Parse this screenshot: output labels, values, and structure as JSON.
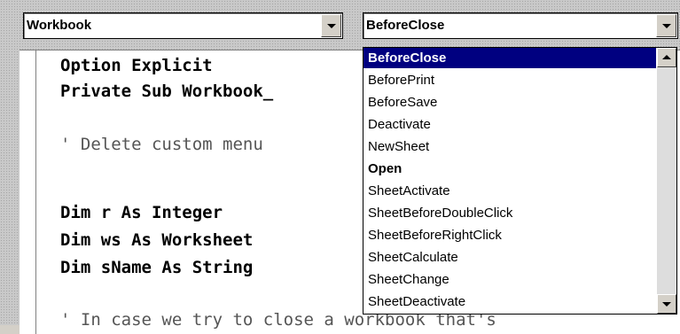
{
  "object_combo": {
    "value": "Workbook"
  },
  "procedure_combo": {
    "value": "BeforeClose"
  },
  "code": {
    "line1": "Option Explicit",
    "line2": "Private Sub Workbook_",
    "line3": "' Delete custom menu",
    "line4": "Dim r As Integer",
    "line5": "Dim ws As Worksheet",
    "line6": "Dim sName As String",
    "line7": "' In case we try to close a workbook that's"
  },
  "procedure_list": {
    "items": [
      "BeforeClose",
      "BeforePrint",
      "BeforeSave",
      "Deactivate",
      "NewSheet",
      "Open",
      "SheetActivate",
      "SheetBeforeDoubleClick",
      "SheetBeforeRightClick",
      "SheetCalculate",
      "SheetChange",
      "SheetDeactivate"
    ],
    "selected": "BeforeClose",
    "bold_items": [
      "Open"
    ]
  },
  "colors": {
    "selection": "#000080",
    "background": "#d4d0c8"
  }
}
